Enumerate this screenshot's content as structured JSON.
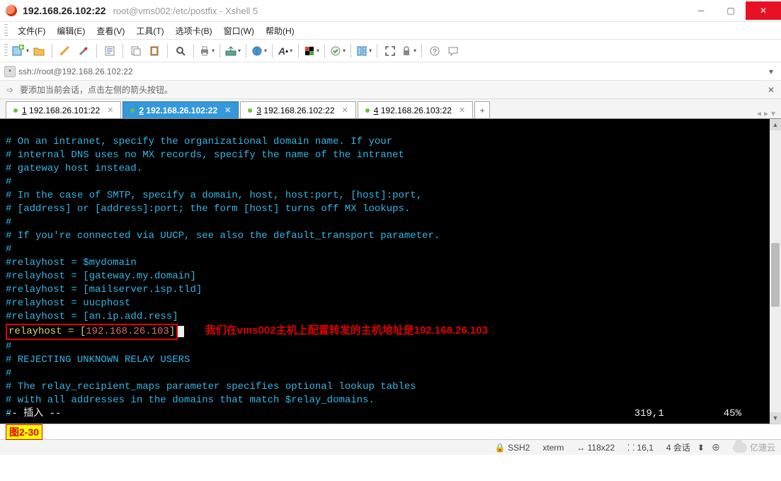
{
  "title": {
    "ip": "192.168.26.102:22",
    "path": "root@vms002:/etc/postfix - Xshell 5"
  },
  "menu": {
    "file": "文件(F)",
    "edit": "编辑(E)",
    "view": "查看(V)",
    "tools": "工具(T)",
    "tabs": "选项卡(B)",
    "window": "窗口(W)",
    "help": "帮助(H)"
  },
  "address": {
    "url": "ssh://root@192.168.26.102:22"
  },
  "hint": {
    "text": "要添加当前会话，点击左侧的箭头按钮。"
  },
  "tabs": {
    "items": [
      {
        "num": "1",
        "label": "192.168.26.101:22",
        "active": false
      },
      {
        "num": "2",
        "label": "192.168.26.102:22",
        "active": true
      },
      {
        "num": "3",
        "label": "192.168.26.102:22",
        "active": false
      },
      {
        "num": "4",
        "label": "192.168.26.103:22",
        "active": false
      }
    ],
    "add": "+"
  },
  "terminal": {
    "lines": [
      "# On an intranet, specify the organizational domain name. If your",
      "# internal DNS uses no MX records, specify the name of the intranet",
      "# gateway host instead.",
      "#",
      "# In the case of SMTP, specify a domain, host, host:port, [host]:port,",
      "# [address] or [address]:port; the form [host] turns off MX lookups.",
      "#",
      "# If you're connected via UUCP, see also the default_transport parameter.",
      "#",
      "#relayhost = $mydomain",
      "#relayhost = [gateway.my.domain]",
      "#relayhost = [mailserver.isp.tld]",
      "#relayhost = uucphost",
      "#relayhost = [an.ip.add.ress]"
    ],
    "relay": {
      "prefix": "relayhost = [",
      "ip": "192.168.26.103",
      "suffix": "]"
    },
    "annotation": "我们在vms002主机上配置转发的主机地址是192.168.26.103",
    "after": [
      "#",
      "# REJECTING UNKNOWN RELAY USERS",
      "#",
      "# The relay_recipient_maps parameter specifies optional lookup tables",
      "# with all addresses in the domains that match $relay_domains.",
      "#"
    ],
    "mode": "-- 插入 --",
    "pos": "319,1",
    "pct": "45%"
  },
  "caption": {
    "label": "图2-30"
  },
  "status": {
    "proto": "SSH2",
    "term": "xterm",
    "size": "118x22",
    "cursor": "16,1",
    "sessions": "4 会话",
    "brand": "亿速云"
  }
}
